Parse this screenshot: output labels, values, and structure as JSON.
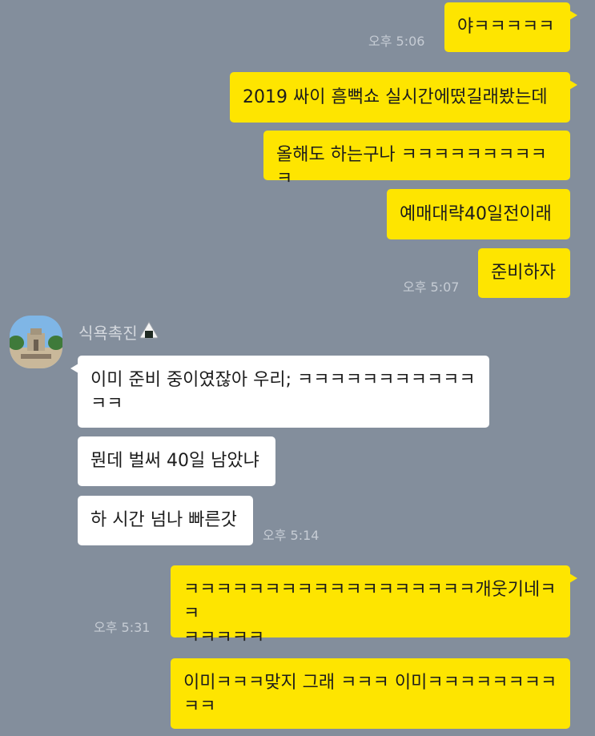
{
  "chat": {
    "sender_name": "식욕촉진",
    "messages": [
      {
        "side": "out",
        "text": "야ㅋㅋㅋㅋㅋ",
        "time": "오후 5:06"
      },
      {
        "side": "out",
        "text": "2019 싸이 흠뻑쇼 실시간에떴길래봤는데",
        "time": ""
      },
      {
        "side": "out",
        "text": "올해도 하는구나 ㅋㅋㅋㅋㅋㅋㅋㅋㅋㅋ",
        "time": ""
      },
      {
        "side": "out",
        "text": "예매대략40일전이래",
        "time": ""
      },
      {
        "side": "out",
        "text": "준비하자",
        "time": "오후 5:07"
      },
      {
        "side": "in",
        "text": "이미 준비 중이였잖아 우리; ㅋㅋㅋㅋㅋㅋㅋㅋㅋㅋㅋ\nㅋㅋ",
        "time": ""
      },
      {
        "side": "in",
        "text": "뭔데 벌써 40일 남았냐",
        "time": ""
      },
      {
        "side": "in",
        "text": "하 시간 넘나 빠른갓",
        "time": "오후 5:14"
      },
      {
        "side": "out",
        "text": "ㅋㅋㅋㅋㅋㅋㅋㅋㅋㅋㅋㅋㅋㅋㅋㅋㅋㅋ개웃기네ㅋㅋ\nㅋㅋㅋㅋㅋ",
        "time": "오후 5:31"
      },
      {
        "side": "out",
        "text": "이미ㅋㅋㅋ맞지 그래 ㅋㅋㅋ 이미ㅋㅋㅋㅋㅋㅋㅋㅋ\nㅋㅋ",
        "time": ""
      }
    ]
  },
  "colors": {
    "background": "#838e9c",
    "outgoing_bubble": "#fee500",
    "incoming_bubble": "#ffffff",
    "time_text": "#c6ccd4"
  },
  "icons": {
    "avatar": "avatar-photo",
    "sender_emoji": "rice-ball-icon"
  }
}
